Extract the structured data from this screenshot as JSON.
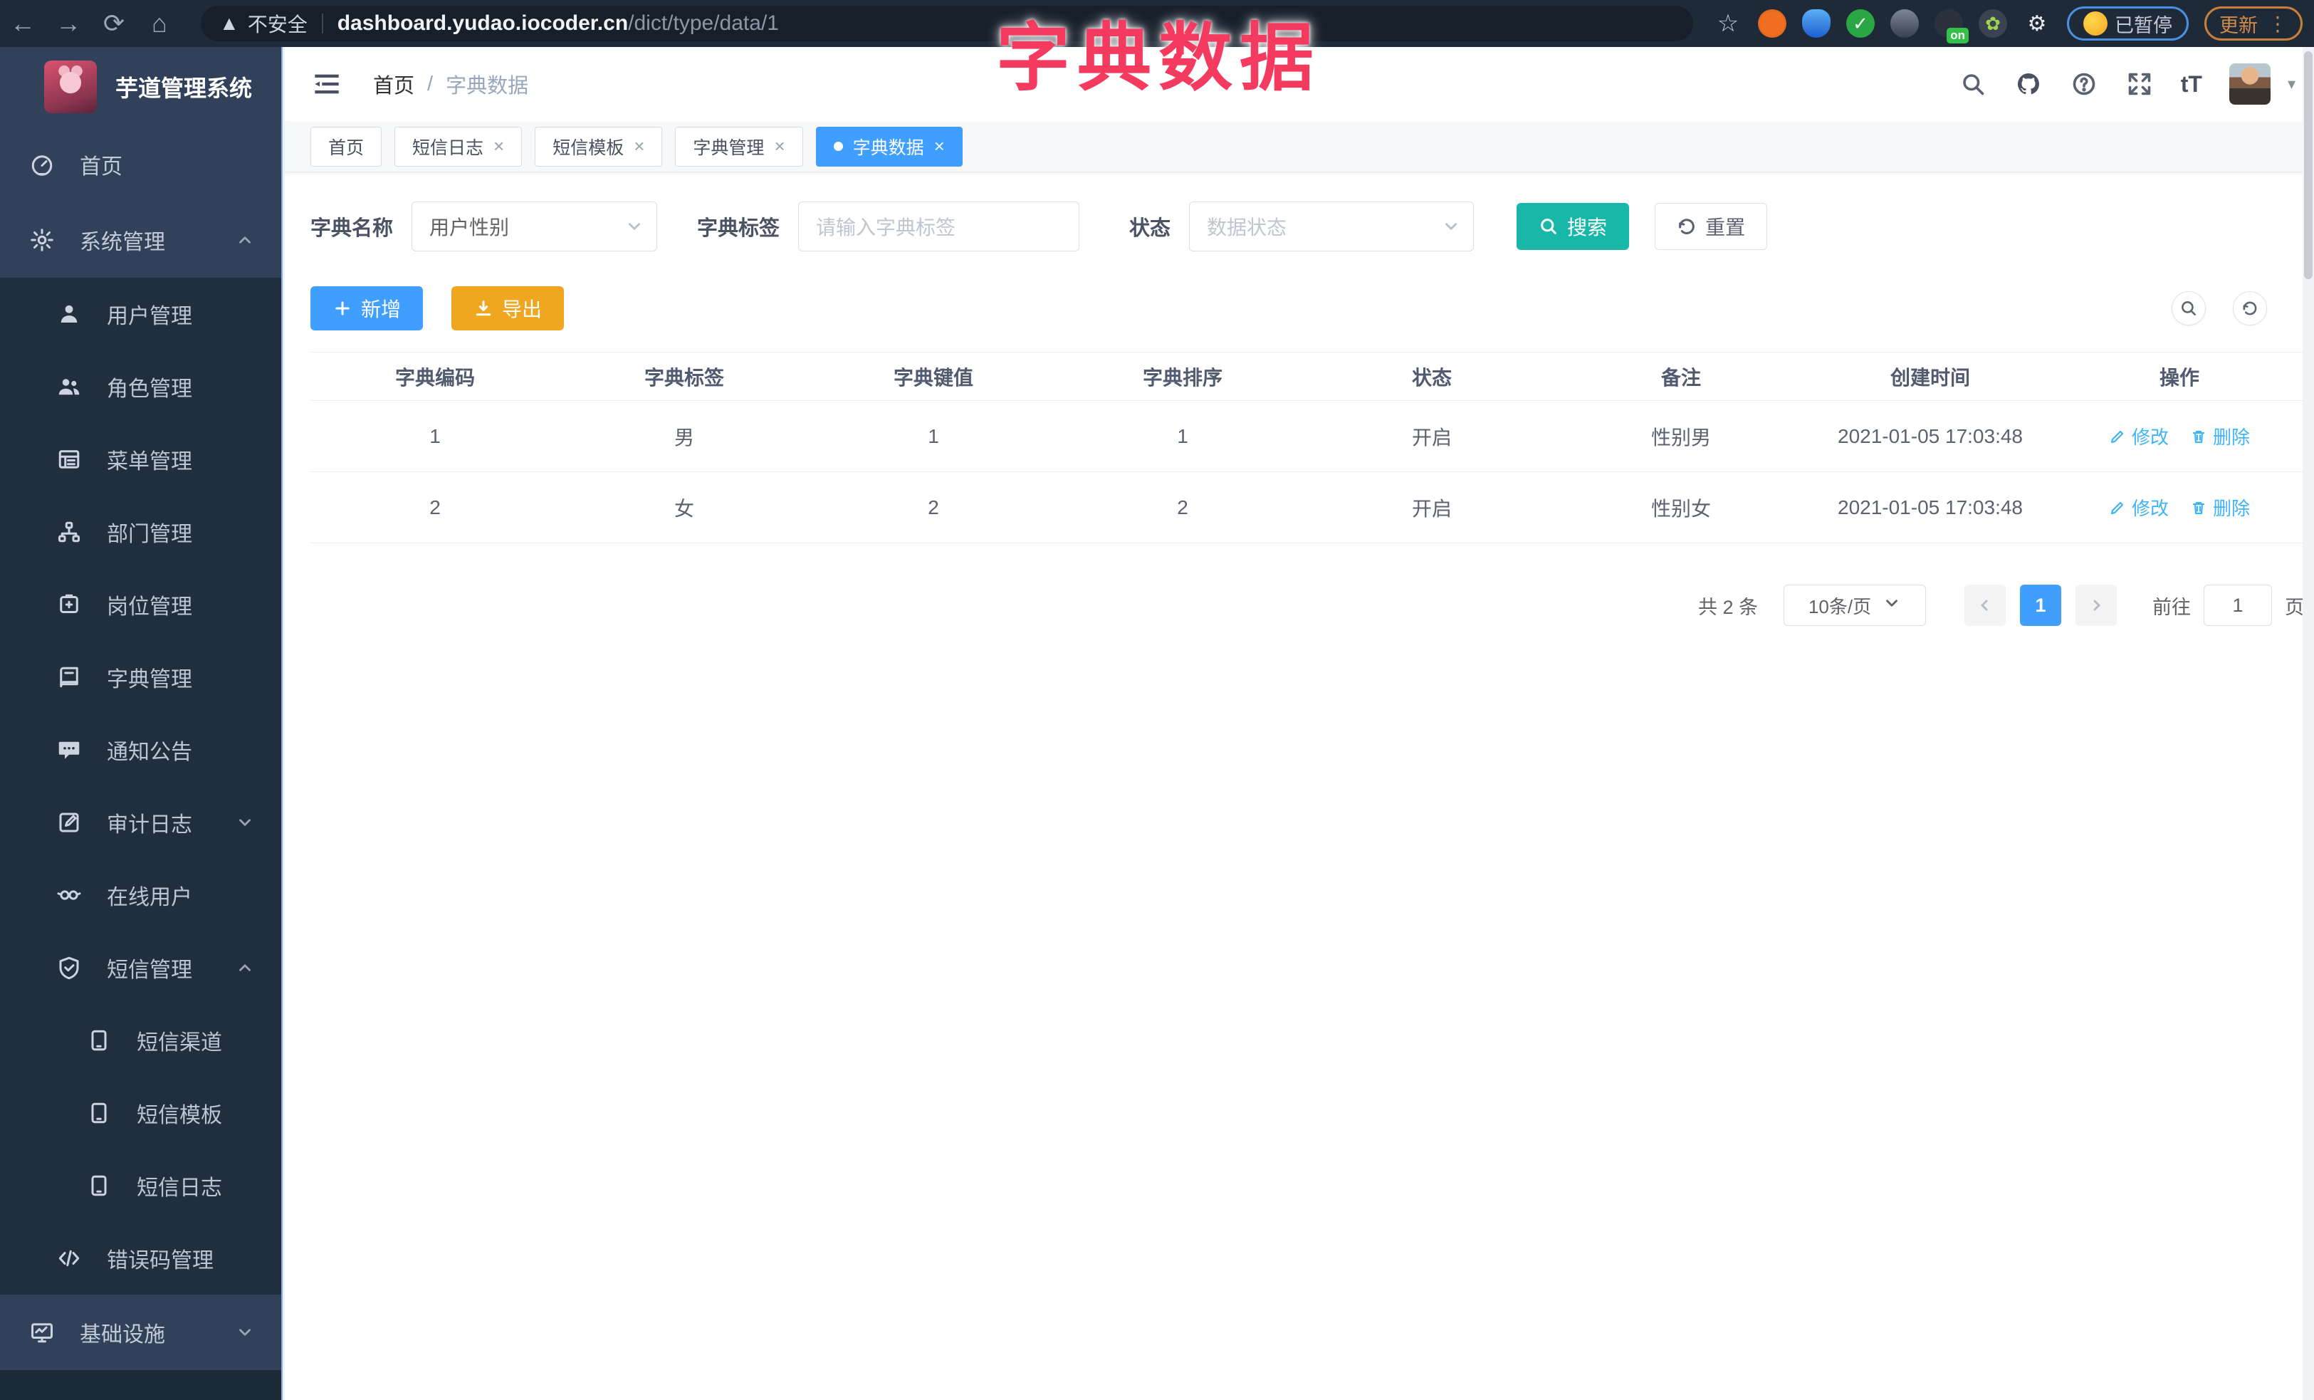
{
  "overlay_title": "字典数据",
  "browser": {
    "security_label": "不安全",
    "url_host": "dashboard.yudao.iocoder.cn",
    "url_path": "/dict/type/data/1",
    "extension_on_badge": "on",
    "paused_label": "已暂停",
    "update_label": "更新"
  },
  "sidebar": {
    "logo_title": "芋道管理系统",
    "menu": [
      {
        "label": "首页"
      },
      {
        "label": "系统管理"
      },
      {
        "label": "用户管理"
      },
      {
        "label": "角色管理"
      },
      {
        "label": "菜单管理"
      },
      {
        "label": "部门管理"
      },
      {
        "label": "岗位管理"
      },
      {
        "label": "字典管理"
      },
      {
        "label": "通知公告"
      },
      {
        "label": "审计日志"
      },
      {
        "label": "在线用户"
      },
      {
        "label": "短信管理"
      },
      {
        "label": "短信渠道"
      },
      {
        "label": "短信模板"
      },
      {
        "label": "短信日志"
      },
      {
        "label": "错误码管理"
      },
      {
        "label": "基础设施"
      }
    ]
  },
  "breadcrumb": {
    "home": "首页",
    "separator": "/",
    "current": "字典数据"
  },
  "tabs": [
    {
      "label": "首页"
    },
    {
      "label": "短信日志"
    },
    {
      "label": "短信模板"
    },
    {
      "label": "字典管理"
    },
    {
      "label": "字典数据"
    }
  ],
  "filters": {
    "name_label": "字典名称",
    "name_value": "用户性别",
    "tag_label": "字典标签",
    "tag_placeholder": "请输入字典标签",
    "status_label": "状态",
    "status_placeholder": "数据状态",
    "search_label": "搜索",
    "reset_label": "重置"
  },
  "toolbar": {
    "add_label": "新增",
    "export_label": "导出"
  },
  "table": {
    "headers": [
      "字典编码",
      "字典标签",
      "字典键值",
      "字典排序",
      "状态",
      "备注",
      "创建时间",
      "操作"
    ],
    "rows": [
      {
        "code": "1",
        "label": "男",
        "value": "1",
        "sort": "1",
        "status": "开启",
        "remark": "性别男",
        "created": "2021-01-05 17:03:48",
        "edit": "修改",
        "delete": "删除"
      },
      {
        "code": "2",
        "label": "女",
        "value": "2",
        "sort": "2",
        "status": "开启",
        "remark": "性别女",
        "created": "2021-01-05 17:03:48",
        "edit": "修改",
        "delete": "删除"
      }
    ]
  },
  "pagination": {
    "total": "共 2 条",
    "page_size": "10条/页",
    "current_page": "1",
    "goto_label": "前往",
    "goto_value": "1",
    "page_unit": "页"
  },
  "colors": {
    "primary": "#409eff",
    "search_button": "#19b7a9",
    "export_button": "#f0a71f",
    "overlay_title": "#f43a5f",
    "sidebar_bg": "#31415a",
    "submenu_bg": "#202e3e",
    "action_link": "#40b4f5"
  }
}
